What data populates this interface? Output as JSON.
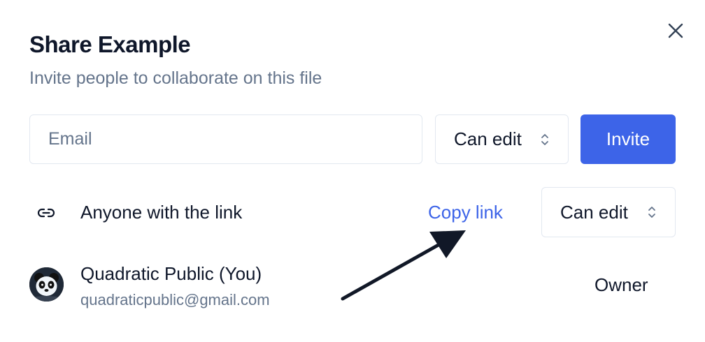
{
  "dialog": {
    "title": "Share Example",
    "subtitle": "Invite people to collaborate on this file",
    "close_icon": "close-icon"
  },
  "invite": {
    "email_placeholder": "Email",
    "email_value": "",
    "permission": "Can edit",
    "button_label": "Invite"
  },
  "link_sharing": {
    "icon": "link-icon",
    "label": "Anyone with the link",
    "copy_label": "Copy link",
    "permission": "Can edit"
  },
  "members": [
    {
      "name": "Quadratic Public (You)",
      "email": "quadraticpublic@gmail.com",
      "role": "Owner",
      "avatar": "panda-avatar"
    }
  ],
  "colors": {
    "accent": "#3d64e8",
    "text": "#0f172a",
    "muted": "#64748b",
    "border": "#e2e8f0"
  }
}
